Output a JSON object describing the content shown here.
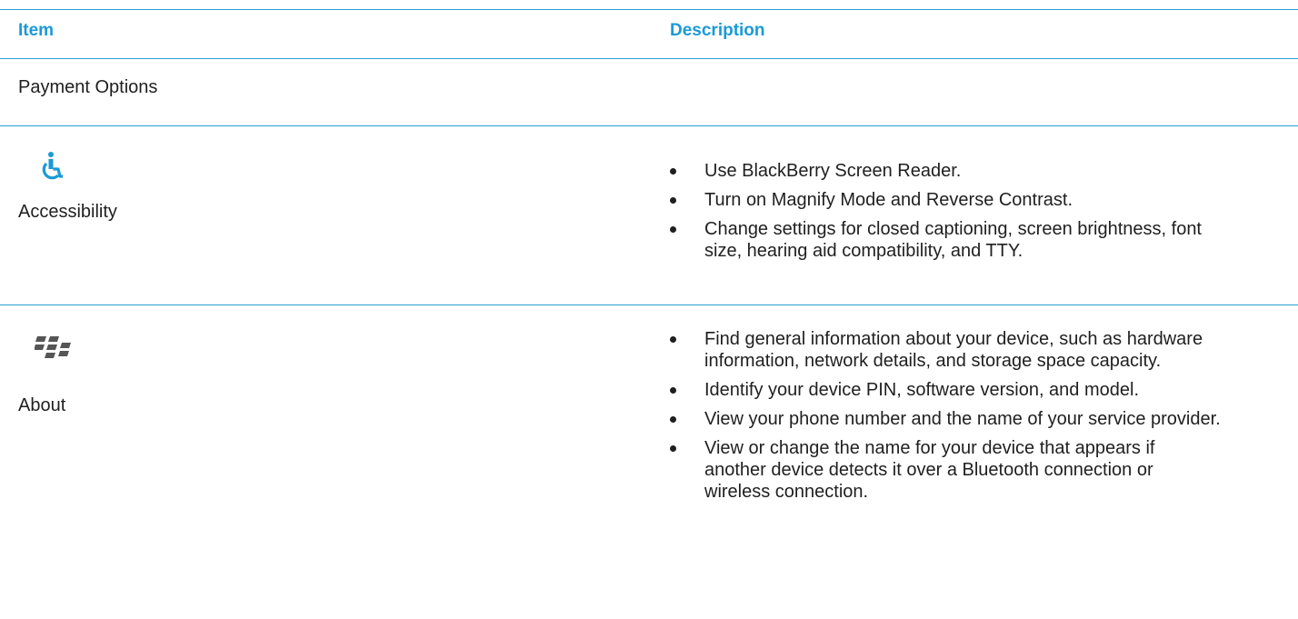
{
  "table": {
    "headers": {
      "item": "Item",
      "description": "Description"
    },
    "section_row": {
      "label": "Payment Options"
    },
    "rows": [
      {
        "item": "Accessibility",
        "icon": "wheelchair-icon",
        "bullets": [
          "Use BlackBerry Screen Reader.",
          "Turn on Magnify Mode and Reverse Contrast.",
          "Change settings for closed captioning, screen brightness, font size, hearing aid compatibility, and TTY."
        ]
      },
      {
        "item": "About",
        "icon": "blackberry-logo-icon",
        "bullets": [
          "Find general information about your device, such as hardware information, network details, and storage space capacity.",
          "Identify your device PIN, software version, and model.",
          "View your phone number and the name of your service provider.",
          "View or change the name for your device that appears if another device detects it over a Bluetooth connection or wireless connection."
        ]
      }
    ]
  },
  "colors": {
    "accent": "#1a9ad6",
    "rule": "#2b9fd1",
    "text": "#1f1f1f",
    "logo": "#555555"
  }
}
